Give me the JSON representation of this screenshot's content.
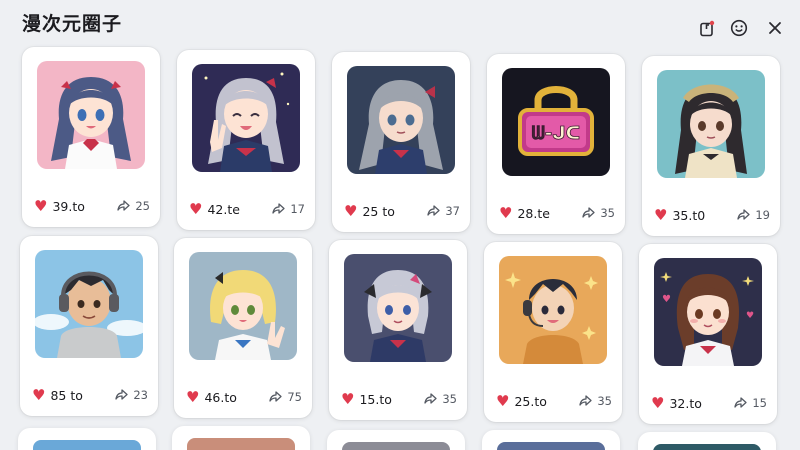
{
  "header": {
    "title": "漫次元圈子",
    "actions": [
      {
        "name": "share-icon",
        "label": "share"
      },
      {
        "name": "emoji-icon",
        "label": "emoji"
      },
      {
        "name": "close-icon",
        "label": "close"
      }
    ]
  },
  "colors": {
    "accent_heart": "#e03a4e",
    "background": "#eef0f3",
    "card": "#ffffff"
  },
  "posts": [
    {
      "likes": "39.to",
      "shares": "25",
      "thumb": "pink-twin-tail-girl"
    },
    {
      "likes": "42.te",
      "shares": "17",
      "thumb": "silver-hair-peace-sign"
    },
    {
      "likes": "25 to",
      "shares": "37",
      "thumb": "grey-hair-twin-tail"
    },
    {
      "likes": "28.te",
      "shares": "35",
      "thumb": "neon-lock-sign",
      "sign_text": "ᗯ-ᒍᑕ"
    },
    {
      "likes": "35.t0",
      "shares": "19",
      "thumb": "dark-hair-bow-girl"
    },
    {
      "likes": "85 to",
      "shares": "23",
      "thumb": "headphone-boy-sky"
    },
    {
      "likes": "46.to",
      "shares": "75",
      "thumb": "blonde-girl-waving"
    },
    {
      "likes": "15.to",
      "shares": "35",
      "thumb": "silver-hair-sailor"
    },
    {
      "likes": "25.to",
      "shares": "35",
      "thumb": "headset-boy-stars"
    },
    {
      "likes": "32.to",
      "shares": "15",
      "thumb": "brown-hair-girl-night"
    }
  ]
}
